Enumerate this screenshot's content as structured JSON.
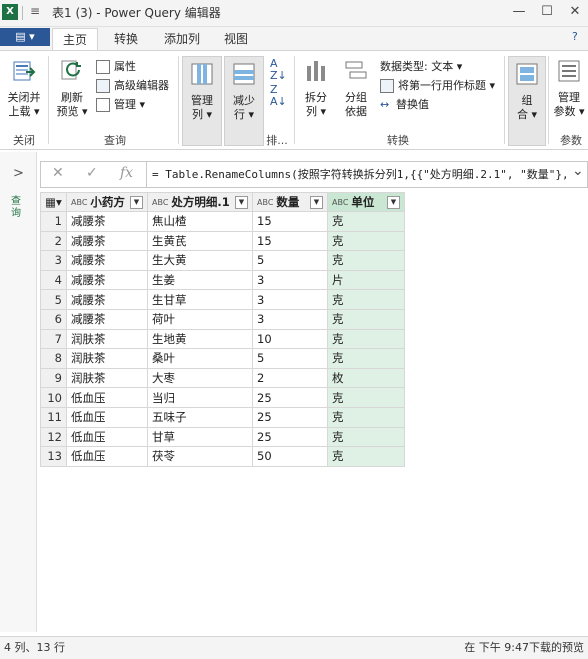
{
  "app": {
    "icon_label": "X",
    "title": "表1 (3) - Power Query 编辑器"
  },
  "window_controls": {
    "minimize": "—",
    "maximize": "☐",
    "close": "✕"
  },
  "file_button": "▤ ▾",
  "tabs": [
    "主页",
    "转换",
    "添加列",
    "视图"
  ],
  "ribbon": {
    "close_load": "关闭并\n上载",
    "close_load_line1": "关闭并",
    "close_load_line2": "上载 ▾",
    "refresh_line1": "刷新",
    "refresh_line2": "预览 ▾",
    "properties": "属性",
    "advanced_editor": "高级编辑器",
    "manage": "管理 ▾",
    "manage_cols_line1": "管理",
    "manage_cols_line2": "列 ▾",
    "reduce_rows_line1": "减少",
    "reduce_rows_line2": "行 ▾",
    "split_col_line1": "拆分",
    "split_col_line2": "列 ▾",
    "group_by_line1": "分组",
    "group_by_line2": "依据",
    "data_type": "数据类型: 文本 ▾",
    "first_row_header": "将第一行用作标题 ▾",
    "replace_values": "替换值",
    "combine_line1": "组",
    "combine_line2": "合 ▾",
    "manage_params_line1": "管理",
    "manage_params_line2": "参数 ▾",
    "group_close": "关闭",
    "group_query": "查询",
    "group_sort": "排...",
    "group_transform": "转换",
    "group_params": "参数"
  },
  "formula": {
    "fx": "fx",
    "text": "= Table.RenameColumns(按照字符转换拆分列1,{{\"处方明细.2.1\", \"数量\"},",
    "expand": "⌄"
  },
  "left_pane": {
    "label": "查询"
  },
  "table": {
    "columns": [
      "小药方",
      "处方明细.1",
      "数量",
      "单位"
    ],
    "type_badge": "ABC",
    "rows": [
      [
        "1",
        "减腰茶",
        "焦山楂",
        "15",
        "克"
      ],
      [
        "2",
        "减腰茶",
        "生黄芪",
        "15",
        "克"
      ],
      [
        "3",
        "减腰茶",
        "生大黄",
        "5",
        "克"
      ],
      [
        "4",
        "减腰茶",
        "生姜",
        "3",
        "片"
      ],
      [
        "5",
        "减腰茶",
        "生甘草",
        "3",
        "克"
      ],
      [
        "6",
        "减腰茶",
        "荷叶",
        "3",
        "克"
      ],
      [
        "7",
        "润肤茶",
        "生地黄",
        "10",
        "克"
      ],
      [
        "8",
        "润肤茶",
        "桑叶",
        "5",
        "克"
      ],
      [
        "9",
        "润肤茶",
        "大枣",
        "2",
        "枚"
      ],
      [
        "10",
        "低血压",
        "当归",
        "25",
        "克"
      ],
      [
        "11",
        "低血压",
        "五味子",
        "25",
        "克"
      ],
      [
        "12",
        "低血压",
        "甘草",
        "25",
        "克"
      ],
      [
        "13",
        "低血压",
        "茯苓",
        "50",
        "克"
      ]
    ]
  },
  "status": {
    "left": "4 列、13 行",
    "right": "在 下午 9:47下载的预览"
  },
  "colors": {
    "excel_green": "#1e7145",
    "selected_column": "#dff0e4",
    "file_button": "#2b5797"
  }
}
